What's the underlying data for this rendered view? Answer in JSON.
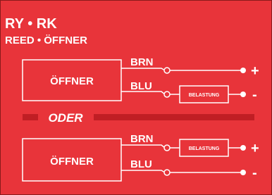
{
  "header": {
    "model_codes": "RY • RK",
    "subtitle": "REED • ÖFFNER"
  },
  "colors": {
    "background": "#e8343a",
    "foreground": "#ffffff",
    "divider": "#c01e24"
  },
  "top_circuit": {
    "switch_label": "ÖFFNER",
    "wires": [
      {
        "label": "BRN",
        "terminal": "+",
        "load": ""
      },
      {
        "label": "BLU",
        "terminal": "-",
        "load": "BELASTUNG"
      }
    ]
  },
  "divider": {
    "label": "ODER"
  },
  "bottom_circuit": {
    "switch_label": "ÖFFNER",
    "wires": [
      {
        "label": "BRN",
        "terminal": "+",
        "load": "BELASTUNG"
      },
      {
        "label": "BLU",
        "terminal": "-",
        "load": ""
      }
    ]
  }
}
